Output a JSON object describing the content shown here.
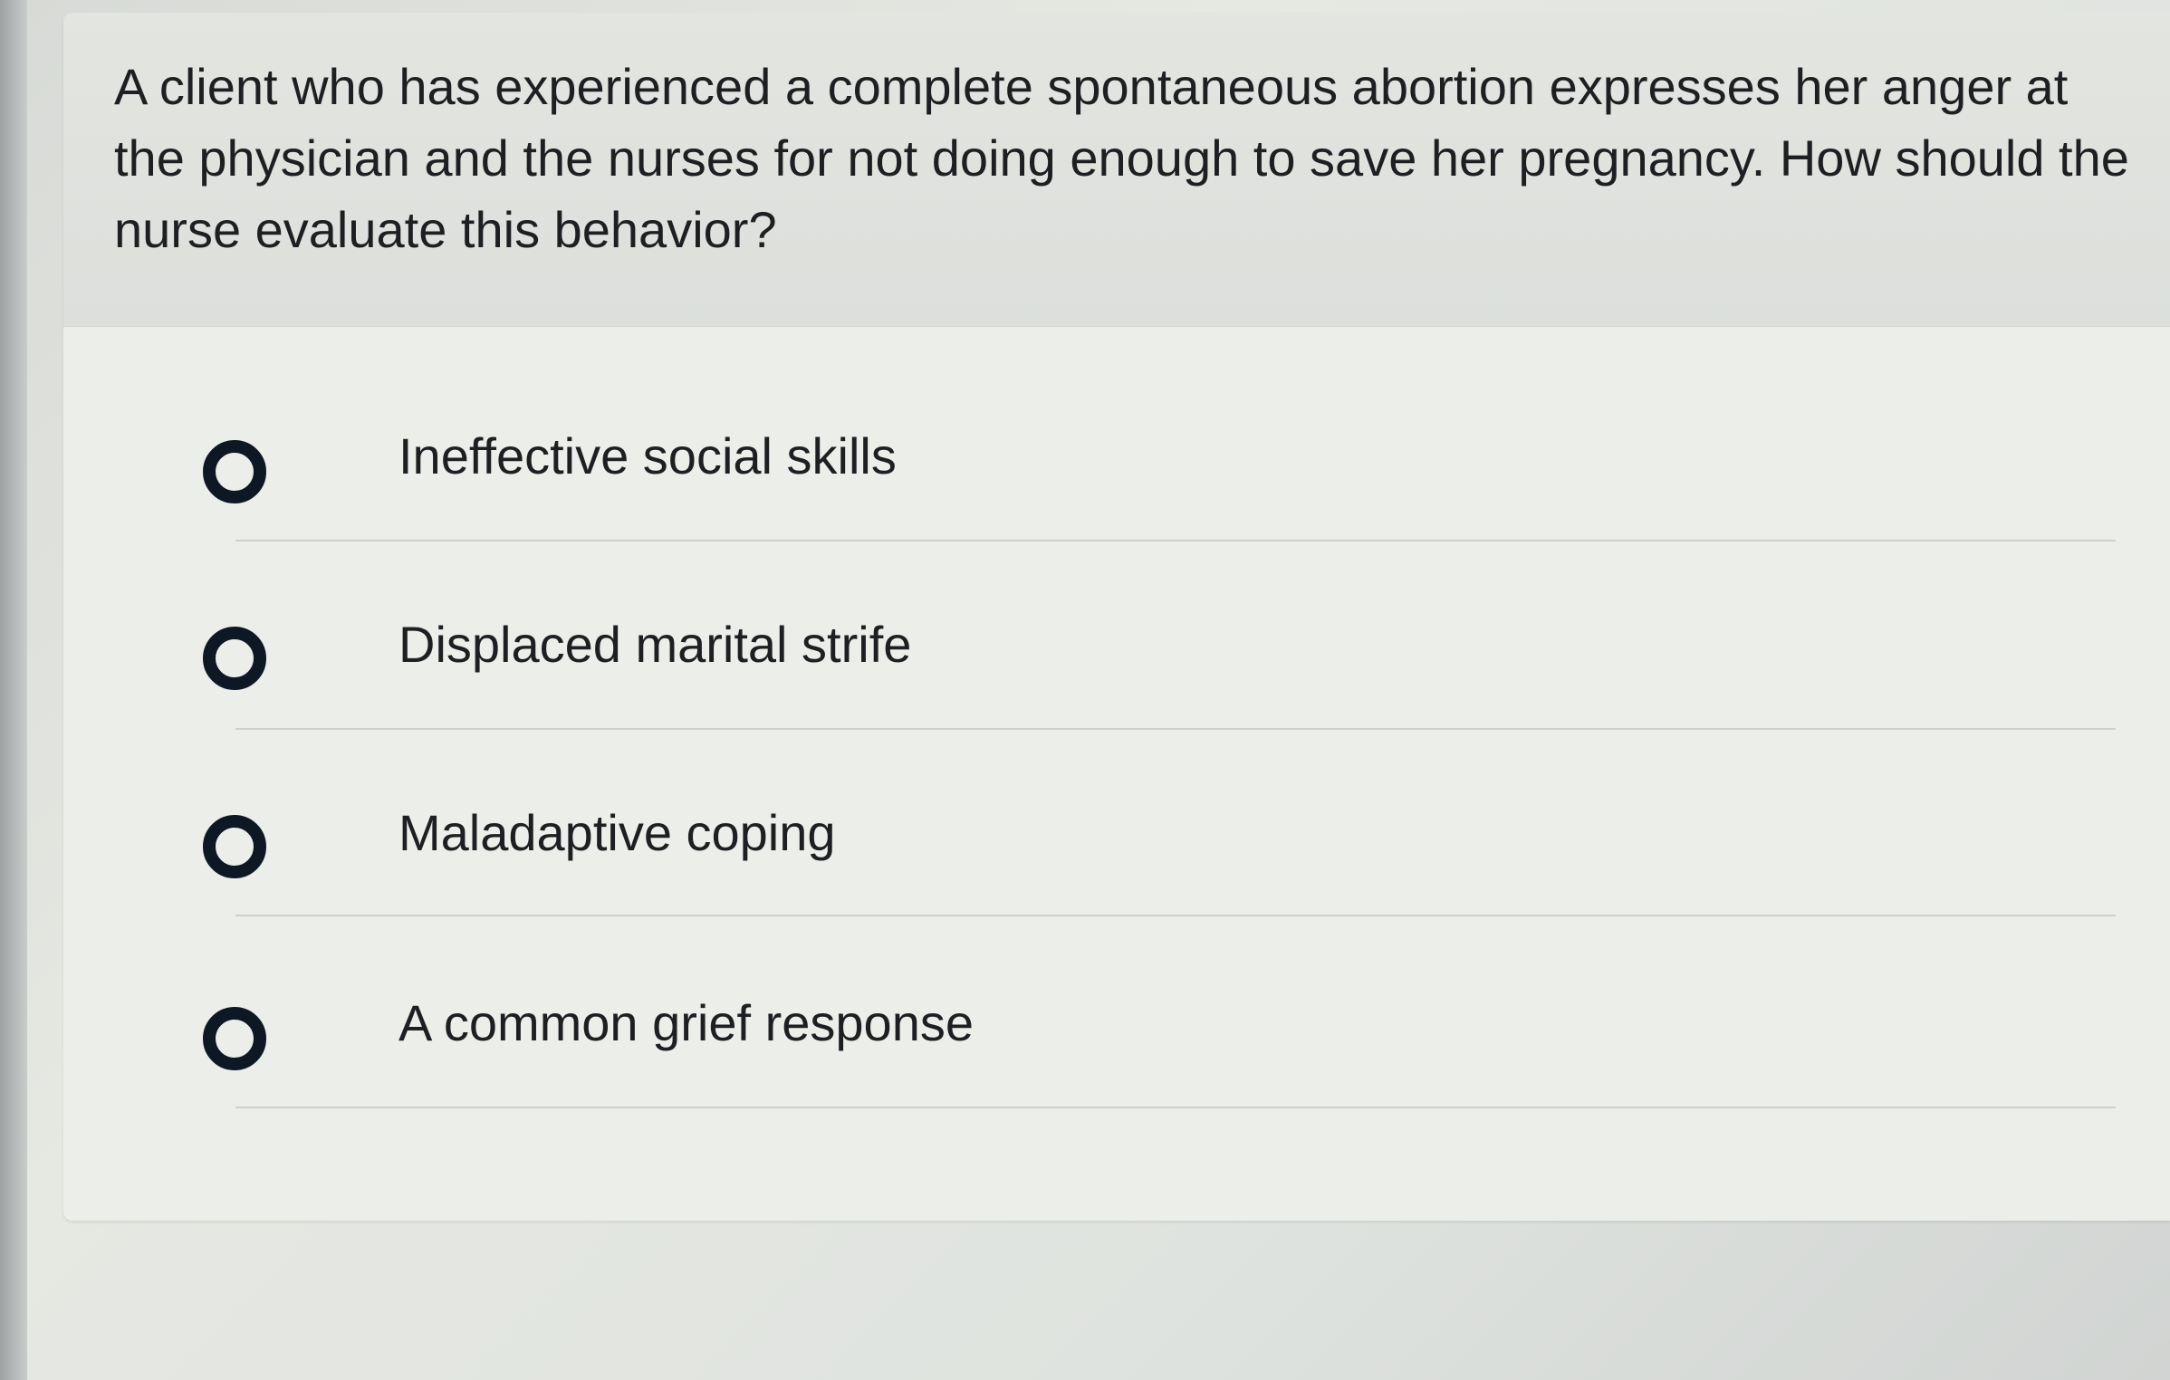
{
  "question": {
    "text": "A client who has experienced a complete spontaneous abortion expresses her anger at the physician and the nurses for not doing enough to save her pregnancy. How should the nurse evaluate this behavior?"
  },
  "options": [
    {
      "label": "Ineffective social skills",
      "selected": false
    },
    {
      "label": "Displaced marital strife",
      "selected": false
    },
    {
      "label": "Maladaptive coping",
      "selected": false
    },
    {
      "label": "A common grief response",
      "selected": false
    }
  ],
  "colors": {
    "radio_border": "#0e1724",
    "text": "#1d1f22",
    "card_background": "#eceeea",
    "header_background": "#dcdfdb"
  }
}
